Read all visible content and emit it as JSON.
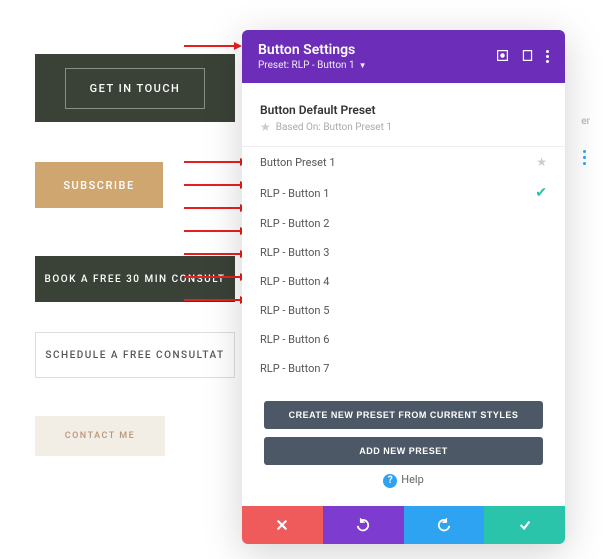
{
  "buttons_preview": {
    "b1": "GET IN TOUCH",
    "b2": "SUBSCRIBE",
    "b3": "BOOK A FREE 30 MIN CONSULT",
    "b4": "SCHEDULE A FREE CONSULTAT",
    "b5": "CONTACT ME"
  },
  "panel": {
    "title": "Button Settings",
    "subtitle": "Preset: RLP - Button 1",
    "default_preset": {
      "name": "Button Default Preset",
      "based_on": "Based On: Button Preset 1"
    },
    "presets": [
      {
        "label": "Button Preset 1",
        "starred": true
      },
      {
        "label": "RLP - Button 1",
        "selected": true
      },
      {
        "label": "RLP - Button 2"
      },
      {
        "label": "RLP - Button 3"
      },
      {
        "label": "RLP - Button 4"
      },
      {
        "label": "RLP - Button 5"
      },
      {
        "label": "RLP - Button 6"
      },
      {
        "label": "RLP - Button 7"
      }
    ],
    "create_from_current": "CREATE NEW PRESET FROM CURRENT STYLES",
    "add_new": "ADD NEW PRESET",
    "help": "Help"
  },
  "side_tag": "er"
}
